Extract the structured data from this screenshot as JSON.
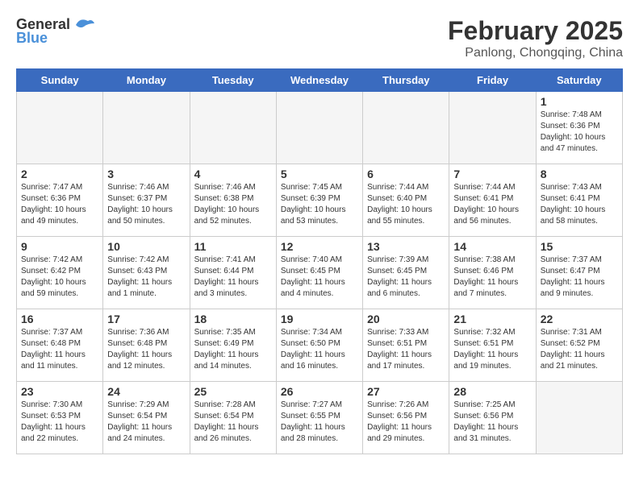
{
  "header": {
    "logo_general": "General",
    "logo_blue": "Blue",
    "title": "February 2025",
    "subtitle": "Panlong, Chongqing, China"
  },
  "days_of_week": [
    "Sunday",
    "Monday",
    "Tuesday",
    "Wednesday",
    "Thursday",
    "Friday",
    "Saturday"
  ],
  "weeks": [
    [
      {
        "num": "",
        "info": ""
      },
      {
        "num": "",
        "info": ""
      },
      {
        "num": "",
        "info": ""
      },
      {
        "num": "",
        "info": ""
      },
      {
        "num": "",
        "info": ""
      },
      {
        "num": "",
        "info": ""
      },
      {
        "num": "1",
        "info": "Sunrise: 7:48 AM\nSunset: 6:36 PM\nDaylight: 10 hours and 47 minutes."
      }
    ],
    [
      {
        "num": "2",
        "info": "Sunrise: 7:47 AM\nSunset: 6:36 PM\nDaylight: 10 hours and 49 minutes."
      },
      {
        "num": "3",
        "info": "Sunrise: 7:46 AM\nSunset: 6:37 PM\nDaylight: 10 hours and 50 minutes."
      },
      {
        "num": "4",
        "info": "Sunrise: 7:46 AM\nSunset: 6:38 PM\nDaylight: 10 hours and 52 minutes."
      },
      {
        "num": "5",
        "info": "Sunrise: 7:45 AM\nSunset: 6:39 PM\nDaylight: 10 hours and 53 minutes."
      },
      {
        "num": "6",
        "info": "Sunrise: 7:44 AM\nSunset: 6:40 PM\nDaylight: 10 hours and 55 minutes."
      },
      {
        "num": "7",
        "info": "Sunrise: 7:44 AM\nSunset: 6:41 PM\nDaylight: 10 hours and 56 minutes."
      },
      {
        "num": "8",
        "info": "Sunrise: 7:43 AM\nSunset: 6:41 PM\nDaylight: 10 hours and 58 minutes."
      }
    ],
    [
      {
        "num": "9",
        "info": "Sunrise: 7:42 AM\nSunset: 6:42 PM\nDaylight: 10 hours and 59 minutes."
      },
      {
        "num": "10",
        "info": "Sunrise: 7:42 AM\nSunset: 6:43 PM\nDaylight: 11 hours and 1 minute."
      },
      {
        "num": "11",
        "info": "Sunrise: 7:41 AM\nSunset: 6:44 PM\nDaylight: 11 hours and 3 minutes."
      },
      {
        "num": "12",
        "info": "Sunrise: 7:40 AM\nSunset: 6:45 PM\nDaylight: 11 hours and 4 minutes."
      },
      {
        "num": "13",
        "info": "Sunrise: 7:39 AM\nSunset: 6:45 PM\nDaylight: 11 hours and 6 minutes."
      },
      {
        "num": "14",
        "info": "Sunrise: 7:38 AM\nSunset: 6:46 PM\nDaylight: 11 hours and 7 minutes."
      },
      {
        "num": "15",
        "info": "Sunrise: 7:37 AM\nSunset: 6:47 PM\nDaylight: 11 hours and 9 minutes."
      }
    ],
    [
      {
        "num": "16",
        "info": "Sunrise: 7:37 AM\nSunset: 6:48 PM\nDaylight: 11 hours and 11 minutes."
      },
      {
        "num": "17",
        "info": "Sunrise: 7:36 AM\nSunset: 6:48 PM\nDaylight: 11 hours and 12 minutes."
      },
      {
        "num": "18",
        "info": "Sunrise: 7:35 AM\nSunset: 6:49 PM\nDaylight: 11 hours and 14 minutes."
      },
      {
        "num": "19",
        "info": "Sunrise: 7:34 AM\nSunset: 6:50 PM\nDaylight: 11 hours and 16 minutes."
      },
      {
        "num": "20",
        "info": "Sunrise: 7:33 AM\nSunset: 6:51 PM\nDaylight: 11 hours and 17 minutes."
      },
      {
        "num": "21",
        "info": "Sunrise: 7:32 AM\nSunset: 6:51 PM\nDaylight: 11 hours and 19 minutes."
      },
      {
        "num": "22",
        "info": "Sunrise: 7:31 AM\nSunset: 6:52 PM\nDaylight: 11 hours and 21 minutes."
      }
    ],
    [
      {
        "num": "23",
        "info": "Sunrise: 7:30 AM\nSunset: 6:53 PM\nDaylight: 11 hours and 22 minutes."
      },
      {
        "num": "24",
        "info": "Sunrise: 7:29 AM\nSunset: 6:54 PM\nDaylight: 11 hours and 24 minutes."
      },
      {
        "num": "25",
        "info": "Sunrise: 7:28 AM\nSunset: 6:54 PM\nDaylight: 11 hours and 26 minutes."
      },
      {
        "num": "26",
        "info": "Sunrise: 7:27 AM\nSunset: 6:55 PM\nDaylight: 11 hours and 28 minutes."
      },
      {
        "num": "27",
        "info": "Sunrise: 7:26 AM\nSunset: 6:56 PM\nDaylight: 11 hours and 29 minutes."
      },
      {
        "num": "28",
        "info": "Sunrise: 7:25 AM\nSunset: 6:56 PM\nDaylight: 11 hours and 31 minutes."
      },
      {
        "num": "",
        "info": ""
      }
    ]
  ]
}
